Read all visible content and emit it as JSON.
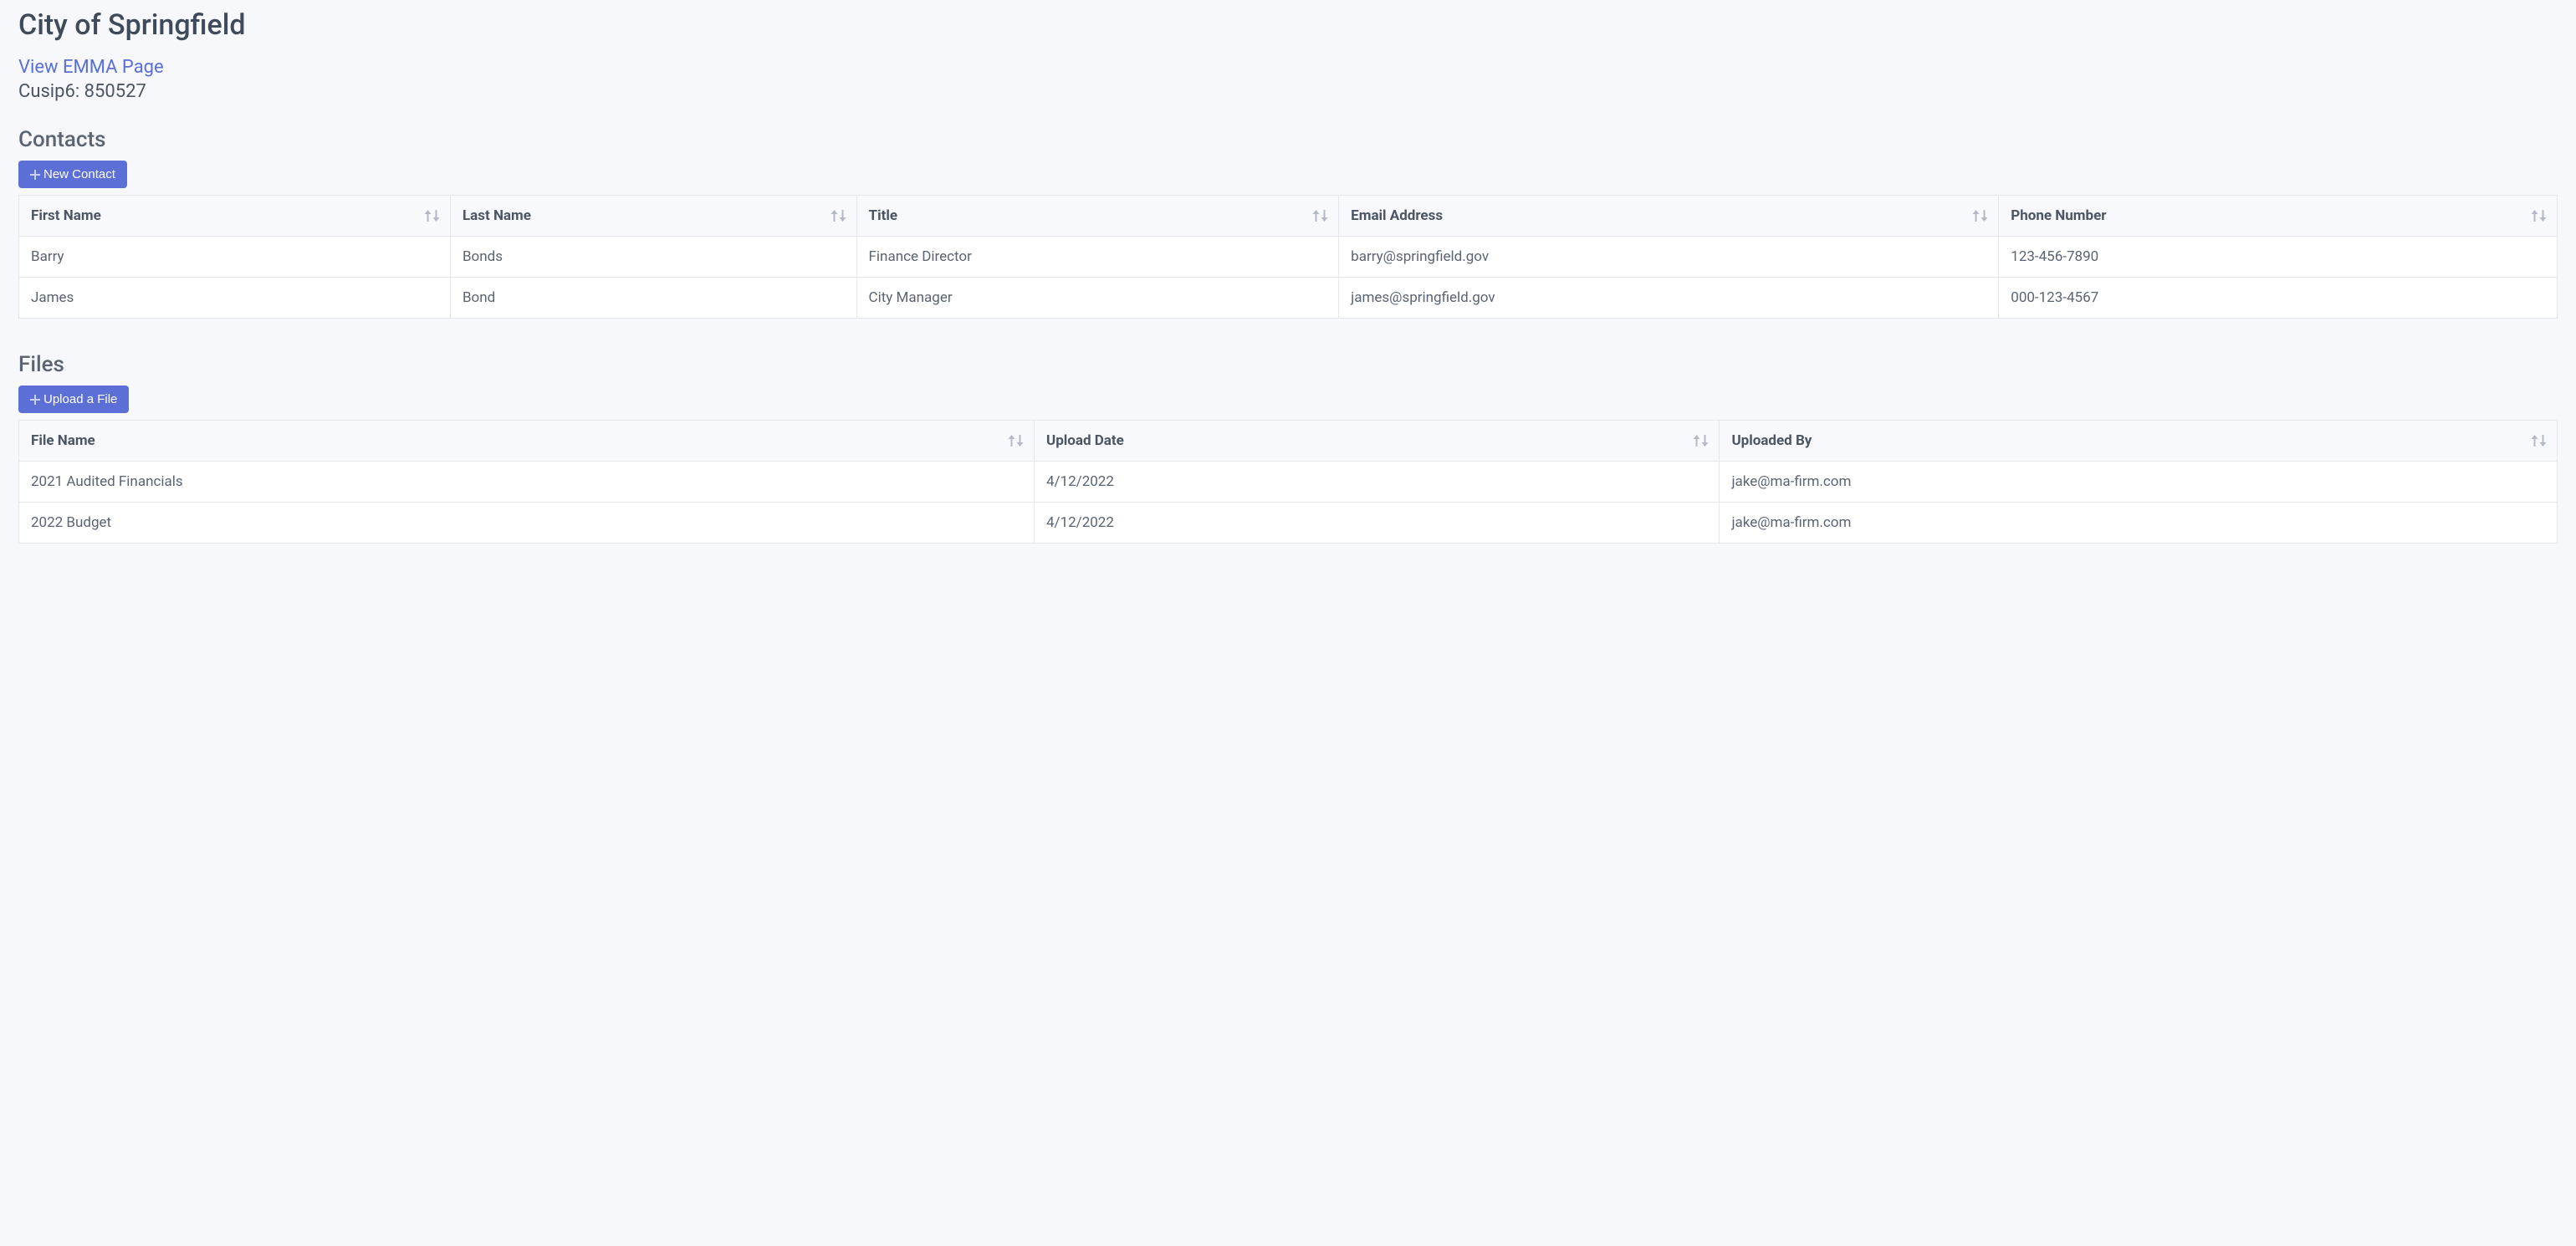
{
  "page_title": "City of Springfield",
  "emma_link_label": "View EMMA Page",
  "cusip_label": "Cusip6: 850527",
  "contacts": {
    "heading": "Contacts",
    "new_button_label": "New Contact",
    "columns": [
      "First Name",
      "Last Name",
      "Title",
      "Email Address",
      "Phone Number"
    ],
    "rows": [
      {
        "first": "Barry",
        "last": "Bonds",
        "title": "Finance Director",
        "email": "barry@springfield.gov",
        "phone": "123-456-7890"
      },
      {
        "first": "James",
        "last": "Bond",
        "title": "City Manager",
        "email": "james@springfield.gov",
        "phone": "000-123-4567"
      }
    ]
  },
  "files": {
    "heading": "Files",
    "upload_button_label": "Upload a File",
    "columns": [
      "File Name",
      "Upload Date",
      "Uploaded By"
    ],
    "rows": [
      {
        "name": "2021 Audited Financials",
        "date": "4/12/2022",
        "by": "jake@ma-firm.com"
      },
      {
        "name": "2022 Budget",
        "date": "4/12/2022",
        "by": "jake@ma-firm.com"
      }
    ]
  }
}
